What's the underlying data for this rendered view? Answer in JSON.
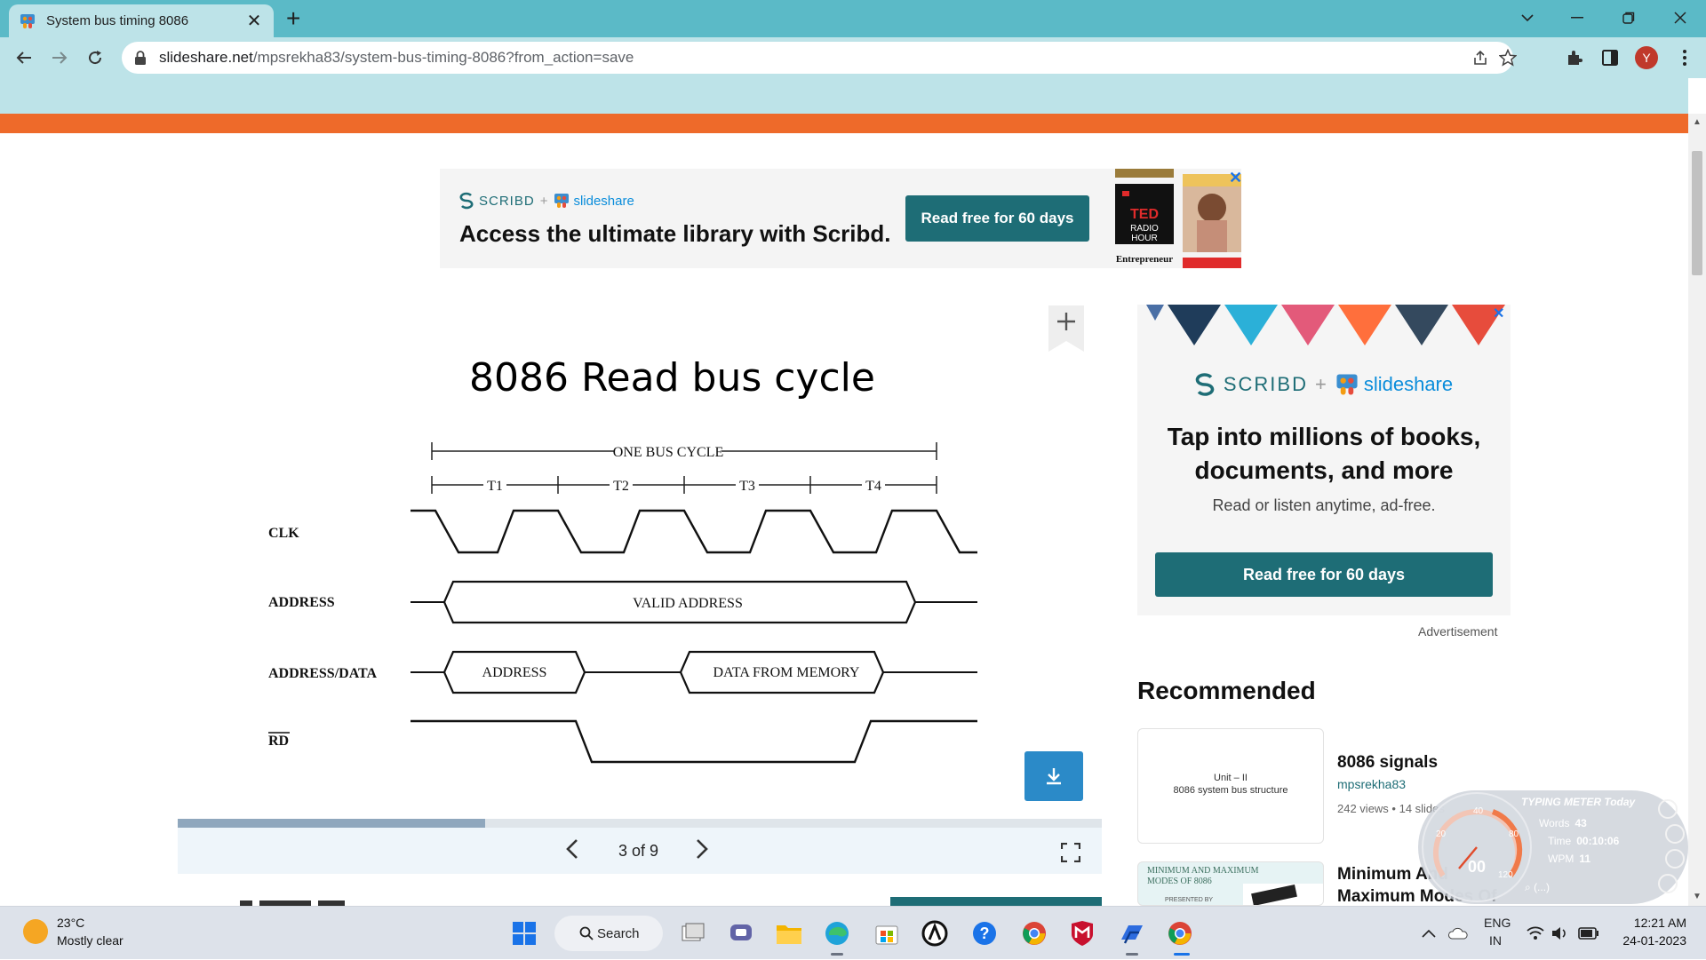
{
  "browser": {
    "tab_title": "System bus timing 8086",
    "tab_close": "✕",
    "new_tab": "+",
    "url_host": "slideshare.net",
    "url_path": "/mpsrekha83/system-bus-timing-8086?from_action=save",
    "profile_initial": "Y"
  },
  "top_ad": {
    "brand_scribd": "SCRIBD",
    "brand_plus": "+",
    "brand_slideshare": "slideshare",
    "headline": "Access the ultimate library with Scribd.",
    "cta": "Read free for 60 days",
    "book_labels": [
      "TED RADIO HOUR",
      "Entrepreneur"
    ]
  },
  "slide": {
    "title": "8086 Read bus cycle",
    "diagram": {
      "one_bus_cycle": "ONE BUS CYCLE",
      "t_states": [
        "T1",
        "T2",
        "T3",
        "T4"
      ],
      "signals": [
        "CLK",
        "ADDRESS",
        "ADDRESS/DATA",
        "RD"
      ],
      "valid_address": "VALID ADDRESS",
      "ad_address": "ADDRESS",
      "ad_data": "DATA FROM MEMORY"
    },
    "progress_fraction": 0.333,
    "counter": "3 of 9"
  },
  "side_ad": {
    "brand_scribd": "SCRIBD",
    "brand_plus": "+",
    "brand_slideshare": "slideshare",
    "headline": "Tap into millions of books, documents, and more",
    "sub": "Read or listen anytime, ad-free.",
    "cta": "Read free for 60 days",
    "label": "Advertisement"
  },
  "recommended": {
    "title": "Recommended",
    "items": [
      {
        "thumb_line1": "Unit – II",
        "thumb_line2": "8086 system bus structure",
        "title": "8086 signals",
        "author": "mpsrekha83",
        "meta": "242 views • 14 slides"
      },
      {
        "thumb_line1": "MINIMUM AND MAXIMUM",
        "thumb_line2": "MODES OF 8086",
        "thumb_line3": "PRESENTED BY",
        "title": "Minimum And Maximum Modes Of"
      }
    ]
  },
  "typing_meter": {
    "title": "TYPING METER Today",
    "words_label": "Words",
    "words_value": "43",
    "time_label": "Time",
    "time_value": "00:10:06",
    "wpm_label": "WPM",
    "wpm_value": "11",
    "gauge_value": "00",
    "gauge_ticks": [
      "20",
      "40",
      "80",
      "120"
    ],
    "search_hint": "(...)"
  },
  "taskbar": {
    "temp": "23°C",
    "weather": "Mostly clear",
    "search": "Search",
    "lang1": "ENG",
    "lang2": "IN",
    "time": "12:21 AM",
    "date": "24-01-2023"
  }
}
